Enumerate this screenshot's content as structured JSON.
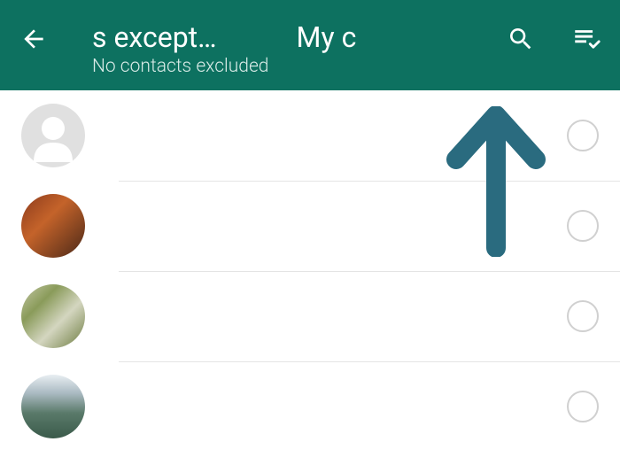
{
  "header": {
    "title_main": "s except…",
    "title_secondary": "My c",
    "subtitle": "No contacts excluded"
  },
  "colors": {
    "header_bg": "#0d7160",
    "annotation_arrow": "#2a6b7f"
  },
  "contacts": [
    {
      "avatar_type": "placeholder"
    },
    {
      "avatar_type": "photo1"
    },
    {
      "avatar_type": "photo2"
    },
    {
      "avatar_type": "photo3"
    }
  ]
}
